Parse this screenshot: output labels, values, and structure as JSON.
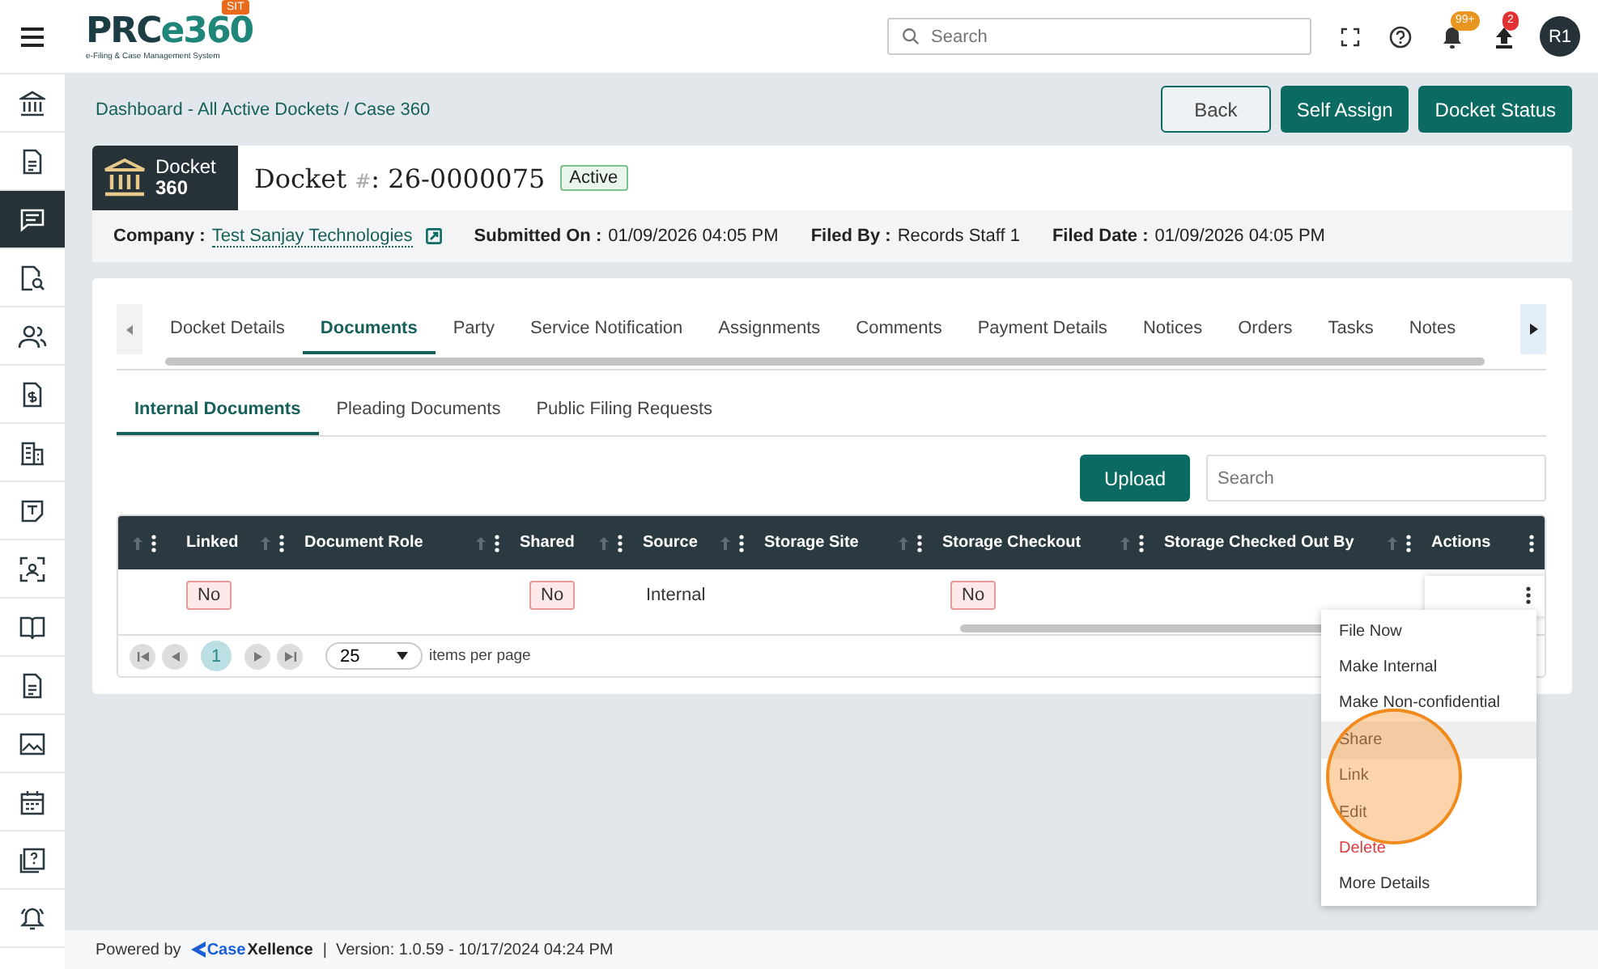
{
  "topbar": {
    "logo": {
      "dark": "PRC",
      "accent": "e360",
      "tagline": "e-Filing & Case Management System",
      "env": "SIT"
    },
    "search": {
      "placeholder": "Search"
    },
    "notifications": "99+",
    "uploads": "2",
    "avatar": "R1"
  },
  "sidebar": {
    "items": [
      {
        "kind": "bank",
        "selected": false
      },
      {
        "kind": "doc",
        "selected": false
      },
      {
        "kind": "chat",
        "selected": true
      },
      {
        "kind": "doc-search",
        "selected": false
      },
      {
        "kind": "users",
        "selected": false
      },
      {
        "kind": "doc-money",
        "selected": false
      },
      {
        "kind": "building",
        "selected": false
      },
      {
        "kind": "note",
        "selected": false
      },
      {
        "kind": "scan",
        "selected": false
      },
      {
        "kind": "book",
        "selected": false
      },
      {
        "kind": "doc",
        "selected": false
      },
      {
        "kind": "image",
        "selected": false
      },
      {
        "kind": "calendar",
        "selected": false
      },
      {
        "kind": "help-doc",
        "selected": false
      },
      {
        "kind": "bell",
        "selected": false
      }
    ]
  },
  "breadcrumb": "Dashboard - All Active Dockets / Case 360",
  "actions": [
    {
      "label": "Back",
      "kind": "outline"
    },
    {
      "label": "Self Assign",
      "kind": "primary"
    },
    {
      "label": "Docket Status",
      "kind": "primary"
    }
  ],
  "docket": {
    "badge": {
      "line1": "Docket",
      "line2": "360"
    },
    "title": {
      "label": "Docket",
      "hash": "#",
      "number": ": 26-0000075"
    },
    "status": "Active",
    "fields": [
      {
        "label": "Company :",
        "value": "Test Sanjay Technologies",
        "kind": "link"
      },
      {
        "label": "Submitted On :",
        "value": "01/09/2026 04:05 PM",
        "kind": "text"
      },
      {
        "label": "Filed By :",
        "value": "Records Staff 1",
        "kind": "text"
      },
      {
        "label": "Filed Date :",
        "value": "01/09/2026 04:05 PM",
        "kind": "text"
      }
    ]
  },
  "tabs": [
    {
      "label": "Docket Details",
      "selected": false
    },
    {
      "label": "Documents",
      "selected": true
    },
    {
      "label": "Party",
      "selected": false
    },
    {
      "label": "Service Notification",
      "selected": false
    },
    {
      "label": "Assignments",
      "selected": false
    },
    {
      "label": "Comments",
      "selected": false
    },
    {
      "label": "Payment Details",
      "selected": false
    },
    {
      "label": "Notices",
      "selected": false
    },
    {
      "label": "Orders",
      "selected": false
    },
    {
      "label": "Tasks",
      "selected": false
    },
    {
      "label": "Notes",
      "selected": false
    }
  ],
  "subtabs": [
    {
      "label": "Internal Documents",
      "selected": true
    },
    {
      "label": "Pleading Documents",
      "selected": false
    },
    {
      "label": "Public Filing Requests",
      "selected": false
    }
  ],
  "upload_button": "Upload",
  "table_search": {
    "placeholder": "Search"
  },
  "table": {
    "columns": [
      {},
      {
        "label": "Linked"
      },
      {
        "label": "Document Role"
      },
      {
        "label": "Shared"
      },
      {
        "label": "Source"
      },
      {
        "label": "Storage Site"
      },
      {
        "label": "Storage Checkout"
      },
      {
        "label": "Storage Checked Out By"
      },
      {
        "label": "Actions",
        "kind": "actions"
      }
    ],
    "rows": [
      {
        "cells": [
          {
            "kind": "empty"
          },
          {
            "kind": "badge",
            "text": "No"
          },
          {
            "kind": "empty"
          },
          {
            "kind": "badge",
            "text": "No"
          },
          {
            "kind": "text",
            "text": "Internal"
          },
          {
            "kind": "empty"
          },
          {
            "kind": "badge",
            "text": "No"
          },
          {
            "kind": "empty"
          },
          {
            "kind": "menu"
          }
        ]
      }
    ]
  },
  "pager": {
    "pages": [
      {
        "label": "1",
        "selected": true
      }
    ],
    "page_size": "25",
    "page_size_label": "items per page"
  },
  "context_menu": [
    {
      "label": "File Now",
      "kind": "normal",
      "hovered": false
    },
    {
      "label": "Make Internal",
      "kind": "normal",
      "hovered": false
    },
    {
      "label": "Make Non-confidential",
      "kind": "normal",
      "hovered": false
    },
    {
      "label": "Share",
      "kind": "normal",
      "hovered": true
    },
    {
      "label": "Link",
      "kind": "normal",
      "hovered": false
    },
    {
      "label": "Edit",
      "kind": "normal",
      "hovered": false
    },
    {
      "label": "Delete",
      "kind": "danger",
      "hovered": false
    },
    {
      "label": "More Details",
      "kind": "normal",
      "hovered": false
    }
  ],
  "footer": {
    "powered_by": "Powered by",
    "brand": {
      "accent": "Case",
      "rest": "Xellence"
    },
    "version": "|  Version: 1.0.59 - 10/17/2024 04:24 PM"
  }
}
